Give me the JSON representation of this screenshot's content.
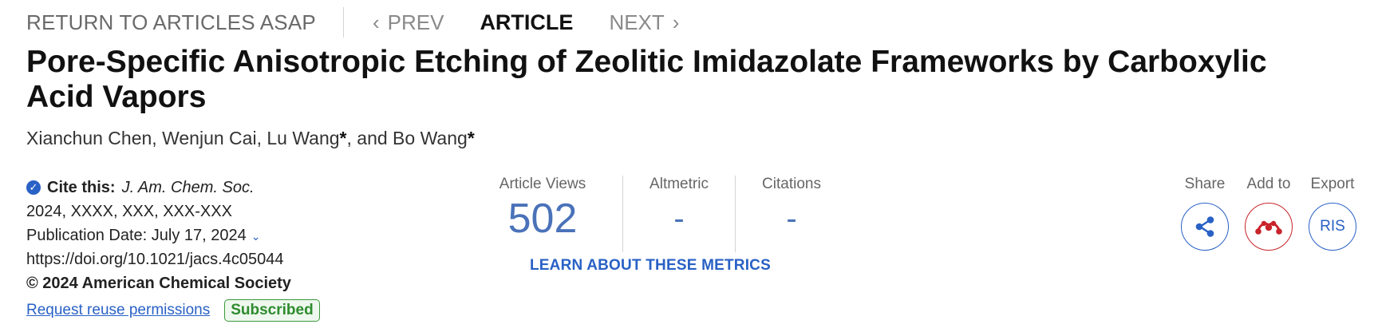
{
  "nav": {
    "return_label": "RETURN TO ARTICLES ASAP",
    "prev_label": "PREV",
    "article_label": "ARTICLE",
    "next_label": "NEXT"
  },
  "article": {
    "title": "Pore-Specific Anisotropic Etching of Zeolitic Imidazolate Frameworks by Carboxylic Acid Vapors",
    "authors": [
      {
        "name": "Xianchun Chen",
        "corresponding": false
      },
      {
        "name": "Wenjun Cai",
        "corresponding": false
      },
      {
        "name": "Lu Wang",
        "corresponding": true
      },
      {
        "name": "Bo Wang",
        "corresponding": true
      }
    ],
    "author_separators": [
      ", ",
      ", ",
      ", and "
    ],
    "corresponding_mark": "*"
  },
  "meta": {
    "cite_label": "Cite this:",
    "journal": "J. Am. Chem. Soc.",
    "citation_rest": "2024, XXXX, XXX, XXX-XXX",
    "publication_date_label": "Publication Date:",
    "publication_date": "July 17, 2024",
    "doi": "https://doi.org/10.1021/jacs.4c05044",
    "copyright": "© 2024 American Chemical Society",
    "reuse_link": "Request reuse permissions",
    "access_badge": "Subscribed"
  },
  "metrics": {
    "views_label": "Article Views",
    "views_value": "502",
    "altmetric_label": "Altmetric",
    "altmetric_value": "-",
    "citations_label": "Citations",
    "citations_value": "-",
    "learn_link": "LEARN ABOUT THESE METRICS"
  },
  "actions": {
    "share_label": "Share",
    "add_to_label": "Add to",
    "export_label": "Export",
    "ris_label": "RIS"
  },
  "icons": {
    "verified": "check-circle-icon",
    "share": "share-icon",
    "mendeley": "mendeley-icon"
  },
  "colors": {
    "link_blue": "#2961c5",
    "metric_blue": "#4a72b9",
    "mendeley_red": "#c8242a",
    "badge_green": "#2e8b2e"
  }
}
